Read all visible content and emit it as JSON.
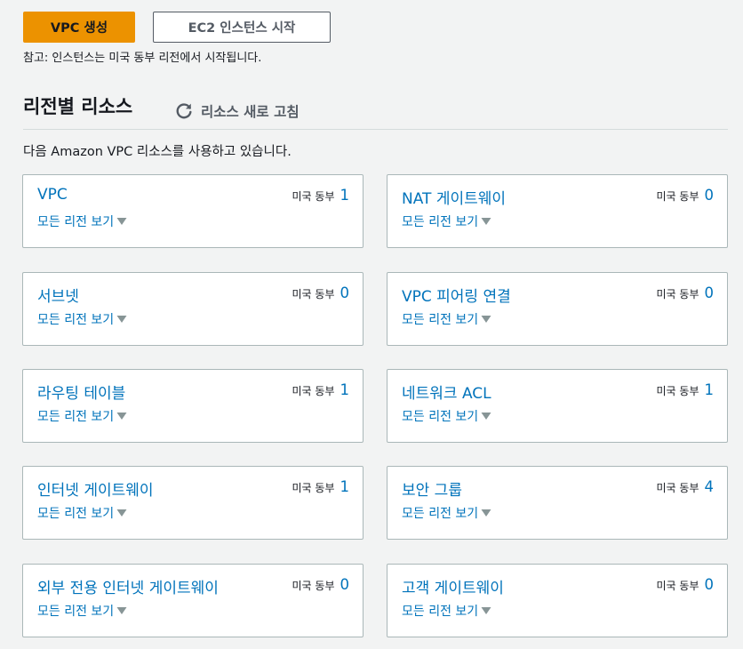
{
  "actions": {
    "create_vpc_label": "VPC 생성",
    "launch_ec2_label": "EC2 인스턴스 시작",
    "note": "참고: 인스턴스는 미국 동부 리전에서 시작됩니다."
  },
  "resources": {
    "title": "리전별 리소스",
    "refresh_label": "리소스 새로 고침",
    "refresh_icon": "refresh-icon",
    "description": "다음 Amazon VPC 리소스를 사용하고 있습니다.",
    "cards": [
      {
        "title": "VPC",
        "region": "미국 동부",
        "count": "1",
        "link": "모든 리전 보기"
      },
      {
        "title": "NAT 게이트웨이",
        "region": "미국 동부",
        "count": "0",
        "link": "모든 리전 보기"
      },
      {
        "title": "서브넷",
        "region": "미국 동부",
        "count": "0",
        "link": "모든 리전 보기"
      },
      {
        "title": "VPC 피어링 연결",
        "region": "미국 동부",
        "count": "0",
        "link": "모든 리전 보기"
      },
      {
        "title": "라우팅 테이블",
        "region": "미국 동부",
        "count": "1",
        "link": "모든 리전 보기"
      },
      {
        "title": "네트워크 ACL",
        "region": "미국 동부",
        "count": "1",
        "link": "모든 리전 보기"
      },
      {
        "title": "인터넷 게이트웨이",
        "region": "미국 동부",
        "count": "1",
        "link": "모든 리전 보기"
      },
      {
        "title": "보안 그룹",
        "region": "미국 동부",
        "count": "4",
        "link": "모든 리전 보기"
      },
      {
        "title": "외부 전용 인터넷 게이트웨이",
        "region": "미국 동부",
        "count": "0",
        "link": "모든 리전 보기"
      },
      {
        "title": "고객 게이트웨이",
        "region": "미국 동부",
        "count": "0",
        "link": "모든 리전 보기"
      }
    ]
  },
  "colors": {
    "primary_button": "#ec9200",
    "link": "#0073bb",
    "background": "#f2f3f3",
    "card_border": "#aab7b8",
    "caret": "#879596"
  }
}
